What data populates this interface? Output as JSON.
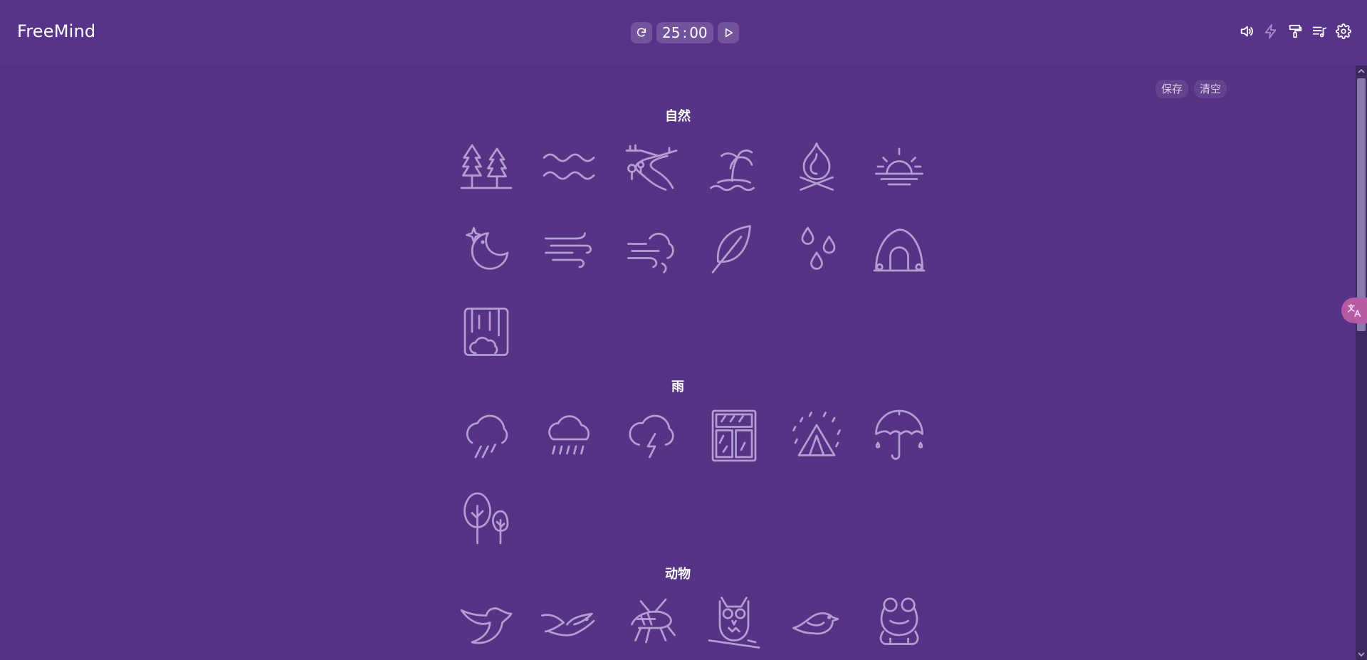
{
  "app": {
    "title": "FreeMind"
  },
  "timer": {
    "minutes": "25",
    "separator": ":",
    "seconds": "00",
    "reset_icon": "refresh-icon",
    "play_icon": "play-icon"
  },
  "toolbar": {
    "icons": [
      "volume-icon",
      "lightning-icon",
      "paint-roller-icon",
      "playlist-icon",
      "gear-icon"
    ]
  },
  "actions": {
    "save_label": "保存",
    "clear_label": "清空"
  },
  "sections": [
    {
      "title": "自然",
      "items": [
        "forest-icon",
        "waves-icon",
        "river-icon",
        "palm-island-icon",
        "campfire-icon",
        "sunrise-icon",
        "night-moon-icon",
        "wind-icon",
        "wind-cloud-icon",
        "leaf-icon",
        "water-drops-icon",
        "cave-icon",
        "waterfall-icon"
      ]
    },
    {
      "title": "雨",
      "items": [
        "rain-cloud-icon",
        "heavy-rain-icon",
        "thunder-cloud-icon",
        "rain-window-icon",
        "rain-tent-icon",
        "umbrella-icon",
        "rain-trees-icon"
      ]
    },
    {
      "title": "动物",
      "items": [
        "bird-icon",
        "seagull-icon",
        "cricket-icon",
        "owl-icon",
        "small-bird-icon",
        "frog-icon"
      ]
    }
  ],
  "colors": {
    "background": "#563385",
    "icon_stroke": "#b49dd3",
    "accent_badge": "#b55aa3"
  },
  "floating_badge": {
    "icon": "translate-icon"
  }
}
